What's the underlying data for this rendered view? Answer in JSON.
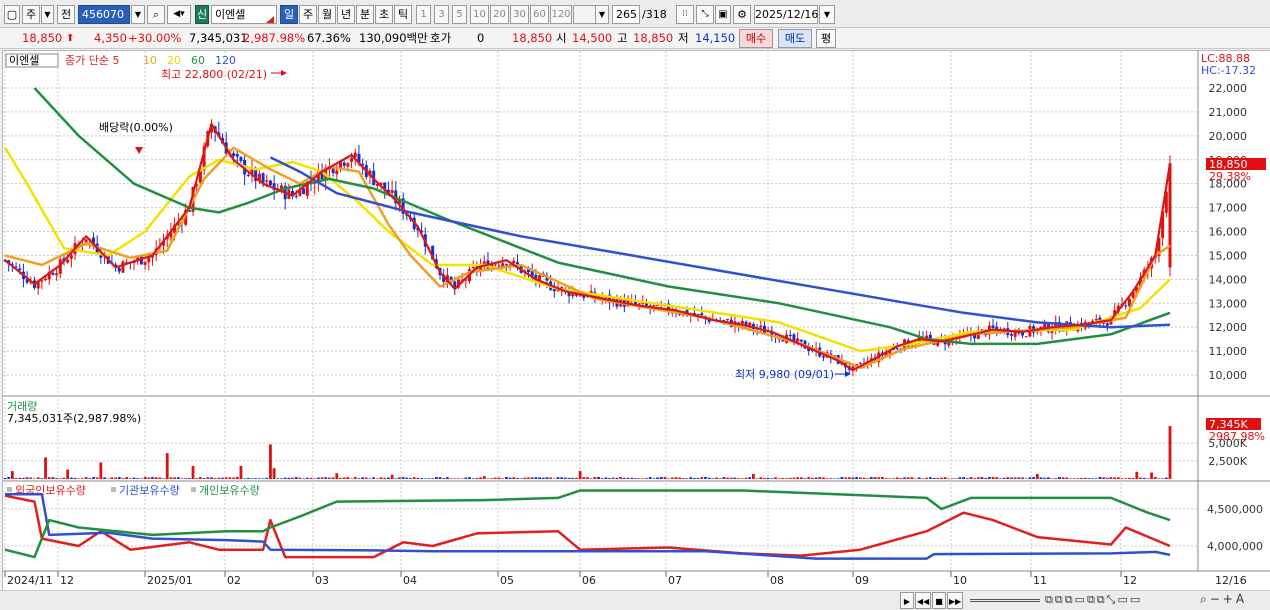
{
  "toolbar": {
    "layout_label": "주",
    "prev_label": "전",
    "code": "456070",
    "stock_badge": "신",
    "stock_name": "이엔셀",
    "periods": [
      "일",
      "주",
      "월",
      "년",
      "분",
      "초",
      "틱"
    ],
    "active_period": "일",
    "numbers": [
      "1",
      "3",
      "5",
      "10",
      "20",
      "30",
      "60",
      "120"
    ],
    "count": "265",
    "count_total": "/318",
    "date": "2025/12/16"
  },
  "quote": {
    "price": "18,850",
    "change": "4,350",
    "change_pct": "+30.00%",
    "volume": "7,345,031",
    "volume_pct": "2,987.98%",
    "turnover_pct": "67.36%",
    "amount": "130,090백만",
    "hoga_label": "호가",
    "hoga_value": "0",
    "hoga_price": "18,850",
    "open_label": "시",
    "open": "14,500",
    "high_label": "고",
    "high": "18,850",
    "low_label": "저",
    "low": "14,150",
    "buy_label": "매수",
    "sell_label": "매도",
    "eval_label": "평"
  },
  "chart_data": [
    {
      "type": "candlestick",
      "title": "이엔셀",
      "legend": [
        "종가 단순 5",
        "10",
        "20",
        "60",
        "120"
      ],
      "legend_colors": [
        "#e02020",
        "#f0a020",
        "#e8d800",
        "#209040",
        "#3050d0"
      ],
      "y_ticks": [
        10000,
        11000,
        12000,
        13000,
        14000,
        15000,
        16000,
        17000,
        18000,
        19000,
        20000,
        21000,
        22000
      ],
      "y_tick_labels": [
        "10,000",
        "11,000",
        "12,000",
        "13,000",
        "14,000",
        "15,000",
        "16,000",
        "17,000",
        "18,000",
        "19,000",
        "20,000",
        "21,000",
        "22,000"
      ],
      "ylim": [
        9400,
        23500
      ],
      "lc_label": "LC:88.88",
      "hc_label": "HC:-17.32",
      "last_price_label": "18,850",
      "last_pct_label": "29.38%",
      "annotations": {
        "high": "최고 22,800 (02/21)",
        "low": "최저 9,980 (09/01)",
        "dividend": "배당락(0.00%)"
      },
      "x_labels": [
        "2024/11",
        "12",
        "2025/01",
        "02",
        "03",
        "04",
        "05",
        "06",
        "07",
        "08",
        "09",
        "10",
        "11",
        "12"
      ],
      "date_label": "12/16",
      "price_points": [
        [
          0,
          14800
        ],
        [
          8,
          13800
        ],
        [
          15,
          14600
        ],
        [
          22,
          15800
        ],
        [
          30,
          14500
        ],
        [
          40,
          15000
        ],
        [
          50,
          17000
        ],
        [
          56,
          20500
        ],
        [
          62,
          19000
        ],
        [
          70,
          18000
        ],
        [
          78,
          17500
        ],
        [
          86,
          18500
        ],
        [
          94,
          19200
        ],
        [
          100,
          18200
        ],
        [
          106,
          17300
        ],
        [
          112,
          16200
        ],
        [
          118,
          14300
        ],
        [
          122,
          13600
        ],
        [
          128,
          14500
        ],
        [
          136,
          14800
        ],
        [
          144,
          14000
        ],
        [
          152,
          13500
        ],
        [
          162,
          13200
        ],
        [
          172,
          12900
        ],
        [
          182,
          12700
        ],
        [
          192,
          12300
        ],
        [
          200,
          12100
        ],
        [
          208,
          11800
        ],
        [
          214,
          11400
        ],
        [
          220,
          11000
        ],
        [
          226,
          10600
        ],
        [
          230,
          10200
        ],
        [
          236,
          10700
        ],
        [
          242,
          11200
        ],
        [
          248,
          11500
        ],
        [
          254,
          11400
        ],
        [
          260,
          11600
        ],
        [
          268,
          11900
        ],
        [
          276,
          11800
        ],
        [
          284,
          12000
        ],
        [
          292,
          12100
        ],
        [
          300,
          12300
        ],
        [
          306,
          13500
        ],
        [
          312,
          15000
        ],
        [
          316,
          18850
        ]
      ],
      "ma120_points": [
        [
          72,
          19100
        ],
        [
          80,
          18500
        ],
        [
          90,
          17600
        ],
        [
          110,
          16800
        ],
        [
          140,
          15800
        ],
        [
          170,
          15000
        ],
        [
          200,
          14200
        ],
        [
          230,
          13400
        ],
        [
          245,
          13000
        ],
        [
          260,
          12600
        ],
        [
          280,
          12200
        ],
        [
          300,
          12000
        ],
        [
          316,
          12100
        ]
      ],
      "ma60_points": [
        [
          8,
          22000
        ],
        [
          20,
          20000
        ],
        [
          35,
          18000
        ],
        [
          50,
          17000
        ],
        [
          58,
          16800
        ],
        [
          66,
          17200
        ],
        [
          76,
          17800
        ],
        [
          88,
          18200
        ],
        [
          100,
          17800
        ],
        [
          120,
          16500
        ],
        [
          150,
          14700
        ],
        [
          180,
          13700
        ],
        [
          210,
          13000
        ],
        [
          240,
          12000
        ],
        [
          250,
          11500
        ],
        [
          262,
          11300
        ],
        [
          280,
          11300
        ],
        [
          300,
          11700
        ],
        [
          316,
          12600
        ]
      ],
      "ma20_points": [
        [
          0,
          19500
        ],
        [
          6,
          18000
        ],
        [
          16,
          15300
        ],
        [
          28,
          15000
        ],
        [
          38,
          16000
        ],
        [
          50,
          18300
        ],
        [
          58,
          19000
        ],
        [
          68,
          18600
        ],
        [
          78,
          18900
        ],
        [
          86,
          18500
        ],
        [
          96,
          17200
        ],
        [
          104,
          16000
        ],
        [
          116,
          14600
        ],
        [
          130,
          14600
        ],
        [
          150,
          13600
        ],
        [
          180,
          12900
        ],
        [
          210,
          12200
        ],
        [
          232,
          11000
        ],
        [
          246,
          11300
        ],
        [
          262,
          11800
        ],
        [
          290,
          11900
        ],
        [
          308,
          12800
        ],
        [
          316,
          14000
        ]
      ],
      "ma10_points": [
        [
          0,
          15000
        ],
        [
          10,
          14600
        ],
        [
          22,
          15500
        ],
        [
          34,
          14900
        ],
        [
          44,
          15200
        ],
        [
          54,
          18200
        ],
        [
          62,
          19500
        ],
        [
          72,
          18600
        ],
        [
          80,
          18000
        ],
        [
          88,
          18700
        ],
        [
          96,
          18500
        ],
        [
          104,
          16300
        ],
        [
          110,
          15000
        ],
        [
          118,
          13700
        ],
        [
          126,
          14300
        ],
        [
          140,
          14600
        ],
        [
          160,
          13200
        ],
        [
          190,
          12400
        ],
        [
          216,
          11300
        ],
        [
          232,
          10300
        ],
        [
          244,
          11100
        ],
        [
          262,
          11700
        ],
        [
          290,
          12000
        ],
        [
          304,
          12400
        ],
        [
          312,
          15000
        ],
        [
          316,
          15400
        ]
      ]
    },
    {
      "type": "bar",
      "title": "거래량",
      "subtitle": "7,345,031주(2,987.98%)",
      "y_ticks": [
        2500,
        5000
      ],
      "y_tick_labels": [
        "2,500K",
        "5,000K"
      ],
      "last_label": "7,345K",
      "last_pct_label": "2987.98%",
      "spikes": [
        [
          2,
          1100
        ],
        [
          11,
          3000
        ],
        [
          17,
          1300
        ],
        [
          26,
          2300
        ],
        [
          44,
          3600
        ],
        [
          51,
          1800
        ],
        [
          64,
          1800
        ],
        [
          72,
          4800
        ],
        [
          73,
          1500
        ],
        [
          90,
          800
        ],
        [
          105,
          600
        ],
        [
          130,
          400
        ],
        [
          156,
          1100
        ],
        [
          203,
          700
        ],
        [
          280,
          700
        ],
        [
          307,
          1000
        ],
        [
          311,
          900
        ],
        [
          316,
          7345
        ]
      ],
      "baseline_volume": 180
    },
    {
      "type": "line",
      "legend": [
        "외국인보유수량",
        "기관보유수량",
        "개인보유수량"
      ],
      "legend_colors": [
        "#e02020",
        "#3050d0",
        "#209040"
      ],
      "y_ticks": [
        4000000,
        4500000
      ],
      "y_tick_labels": [
        "4,000,000",
        "4,500,000"
      ],
      "series": [
        {
          "name": "외국인보유수량",
          "points": [
            [
              0,
              4680000
            ],
            [
              8,
              4600000
            ],
            [
              10,
              4100000
            ],
            [
              20,
              4000000
            ],
            [
              26,
              4200000
            ],
            [
              34,
              3950000
            ],
            [
              50,
              4050000
            ],
            [
              58,
              3950000
            ],
            [
              70,
              3950000
            ],
            [
              72,
              4350000
            ],
            [
              76,
              3850000
            ],
            [
              100,
              3850000
            ],
            [
              104,
              3950000
            ],
            [
              108,
              4050000
            ],
            [
              116,
              4000000
            ],
            [
              128,
              4170000
            ],
            [
              150,
              4200000
            ],
            [
              156,
              3950000
            ],
            [
              180,
              3980000
            ],
            [
              200,
              3900000
            ],
            [
              216,
              3870000
            ],
            [
              232,
              3950000
            ],
            [
              250,
              4200000
            ],
            [
              260,
              4450000
            ],
            [
              268,
              4350000
            ],
            [
              280,
              4120000
            ],
            [
              300,
              4020000
            ],
            [
              304,
              4250000
            ],
            [
              316,
              4000000
            ]
          ]
        },
        {
          "name": "기관보유수량",
          "points": [
            [
              0,
              4700000
            ],
            [
              10,
              4700000
            ],
            [
              12,
              4150000
            ],
            [
              28,
              4180000
            ],
            [
              40,
              4100000
            ],
            [
              60,
              4080000
            ],
            [
              70,
              4060000
            ],
            [
              72,
              3950000
            ],
            [
              100,
              3940000
            ],
            [
              116,
              3930000
            ],
            [
              150,
              3930000
            ],
            [
              190,
              3930000
            ],
            [
              220,
              3830000
            ],
            [
              250,
              3830000
            ],
            [
              252,
              3890000
            ],
            [
              300,
              3900000
            ],
            [
              312,
              3920000
            ],
            [
              316,
              3880000
            ]
          ]
        },
        {
          "name": "개인보유수량",
          "points": [
            [
              0,
              3950000
            ],
            [
              8,
              3850000
            ],
            [
              12,
              4350000
            ],
            [
              20,
              4250000
            ],
            [
              40,
              4150000
            ],
            [
              60,
              4200000
            ],
            [
              70,
              4200000
            ],
            [
              72,
              4250000
            ],
            [
              80,
              4400000
            ],
            [
              90,
              4600000
            ],
            [
              130,
              4620000
            ],
            [
              150,
              4650000
            ],
            [
              156,
              4750000
            ],
            [
              200,
              4750000
            ],
            [
              250,
              4650000
            ],
            [
              254,
              4500000
            ],
            [
              262,
              4650000
            ],
            [
              278,
              4650000
            ],
            [
              300,
              4650000
            ],
            [
              310,
              4450000
            ],
            [
              316,
              4350000
            ]
          ]
        }
      ]
    }
  ]
}
